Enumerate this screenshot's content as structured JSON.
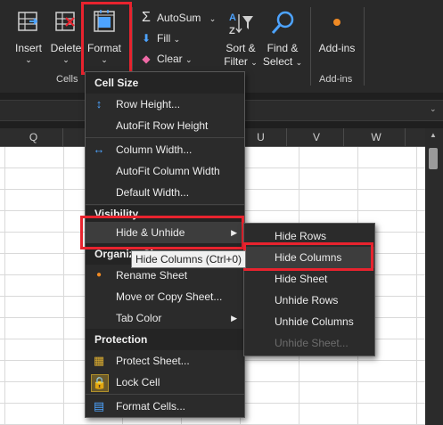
{
  "ribbon": {
    "insert": "Insert",
    "delete": "Delete",
    "format": "Format",
    "cells_group": "Cells",
    "autosum": "AutoSum",
    "fill": "Fill",
    "clear": "Clear",
    "sort_filter_1": "Sort &",
    "sort_filter_2": "Filter",
    "find_select_1": "Find &",
    "find_select_2": "Select",
    "addins": "Add-ins",
    "addins_group": "Add-ins"
  },
  "columns": [
    "Q",
    "U",
    "V",
    "W"
  ],
  "format_menu": {
    "cell_size_header": "Cell Size",
    "row_height": "Row Height...",
    "autofit_row_height": "AutoFit Row Height",
    "column_width": "Column Width...",
    "autofit_column_width": "AutoFit Column Width",
    "default_width": "Default Width...",
    "visibility_header": "Visibility",
    "hide_unhide": "Hide & Unhide",
    "organize_header": "Organize Sheets",
    "rename_sheet": "Rename Sheet",
    "move_copy_sheet": "Move or Copy Sheet...",
    "tab_color": "Tab Color",
    "protection_header": "Protection",
    "protect_sheet": "Protect Sheet...",
    "lock_cell": "Lock Cell",
    "format_cells": "Format Cells..."
  },
  "submenu": {
    "hide_rows": "Hide Rows",
    "hide_columns": "Hide Columns",
    "hide_sheet": "Hide Sheet",
    "unhide_rows": "Unhide Rows",
    "unhide_columns": "Unhide Columns",
    "unhide_sheet": "Unhide Sheet..."
  },
  "tooltip": "Hide Columns (Ctrl+0)",
  "colors": {
    "highlight_box": "#e8232e",
    "menu_bg": "#2b2b2b",
    "ribbon_bg": "#292929"
  }
}
